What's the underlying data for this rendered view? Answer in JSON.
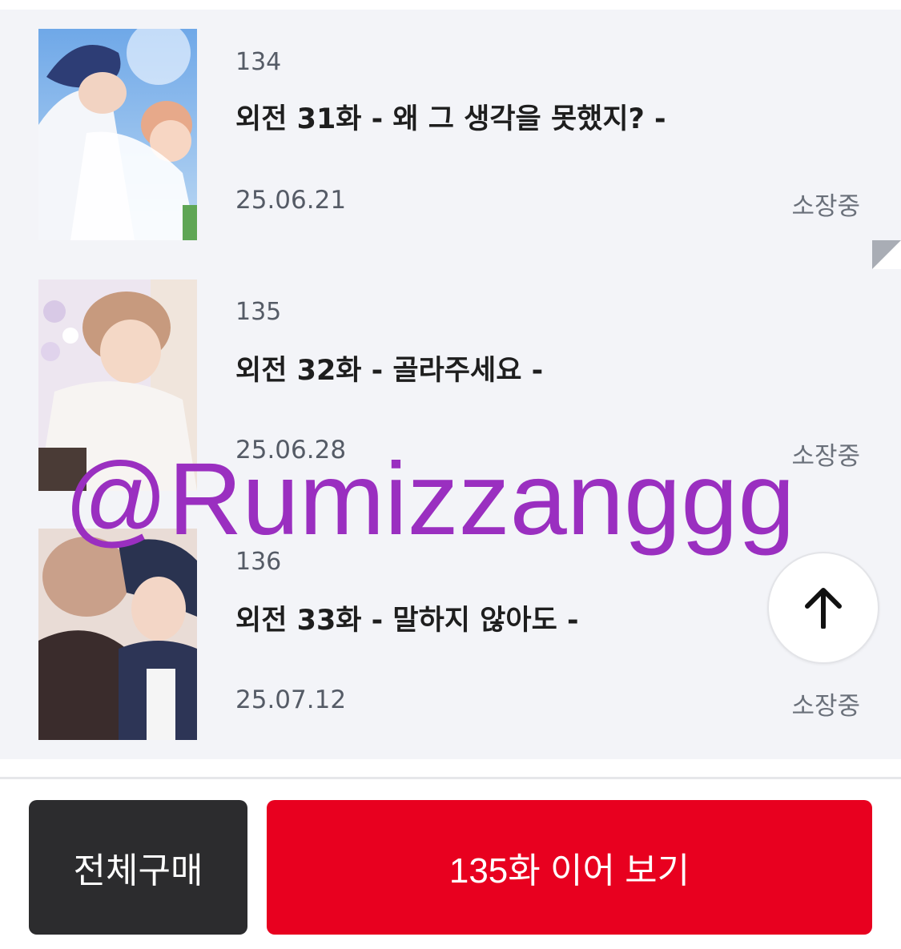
{
  "episodes": [
    {
      "number": "134",
      "title": "외전 31화 - 왜 그 생각을 못했지? -",
      "date": "25.06.21",
      "status": "소장중"
    },
    {
      "number": "135",
      "title": "외전 32화 - 골라주세요 -",
      "date": "25.06.28",
      "status": "소장중"
    },
    {
      "number": "136",
      "title": "외전 33화 - 말하지 않아도 -",
      "date": "25.07.12",
      "status": "소장중"
    }
  ],
  "watermark": "@Rumizzanggg",
  "scroll_top": {
    "icon": "arrow-up-icon"
  },
  "actions": {
    "buy_all_label": "전체구매",
    "continue_label": "135화 이어 보기"
  },
  "colors": {
    "list_background": "#f3f4f8",
    "continue_button": "#e8001f",
    "buy_all_button": "#2c2c2e",
    "watermark": "#9a2fc0"
  }
}
